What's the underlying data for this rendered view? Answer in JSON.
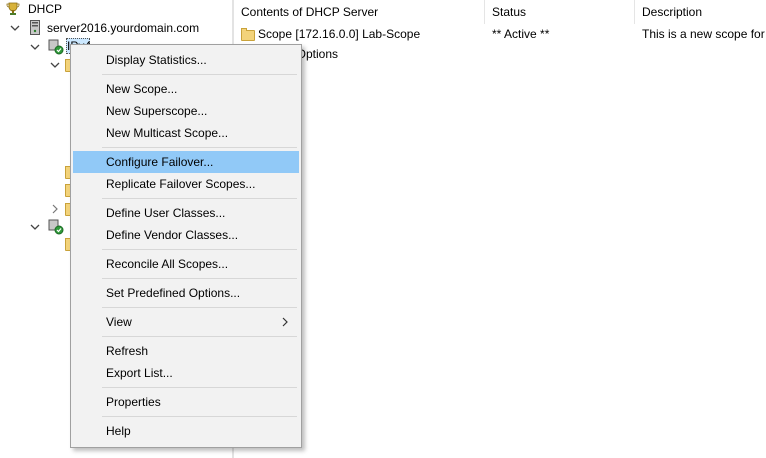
{
  "tree": {
    "root_label": "DHCP",
    "server_label": "server2016.yourdomain.com",
    "ipv4_label": "IPv4"
  },
  "table": {
    "columns": [
      "Contents of DHCP Server",
      "Status",
      "Description"
    ],
    "rows": [
      {
        "name": "Scope [172.16.0.0] Lab-Scope",
        "status": "** Active **",
        "description": "This is a new scope for"
      },
      {
        "name": "Server Options",
        "status": "",
        "description": ""
      }
    ]
  },
  "context_menu": {
    "items": [
      {
        "label": "Display Statistics..."
      },
      {
        "label": "New Scope..."
      },
      {
        "label": "New Superscope..."
      },
      {
        "label": "New Multicast Scope..."
      },
      {
        "label": "Configure Failover...",
        "highlighted": true
      },
      {
        "label": "Replicate Failover Scopes..."
      },
      {
        "label": "Define User Classes..."
      },
      {
        "label": "Define Vendor Classes..."
      },
      {
        "label": "Reconcile All Scopes..."
      },
      {
        "label": "Set Predefined Options..."
      },
      {
        "label": "View",
        "has_submenu": true
      },
      {
        "label": "Refresh"
      },
      {
        "label": "Export List..."
      },
      {
        "label": "Properties"
      },
      {
        "label": "Help"
      }
    ]
  },
  "colors": {
    "menu_highlight": "#91c9f7",
    "menu_background": "#f2f2f2",
    "folder": "#f3d37a",
    "selection": "#cce8ff"
  }
}
